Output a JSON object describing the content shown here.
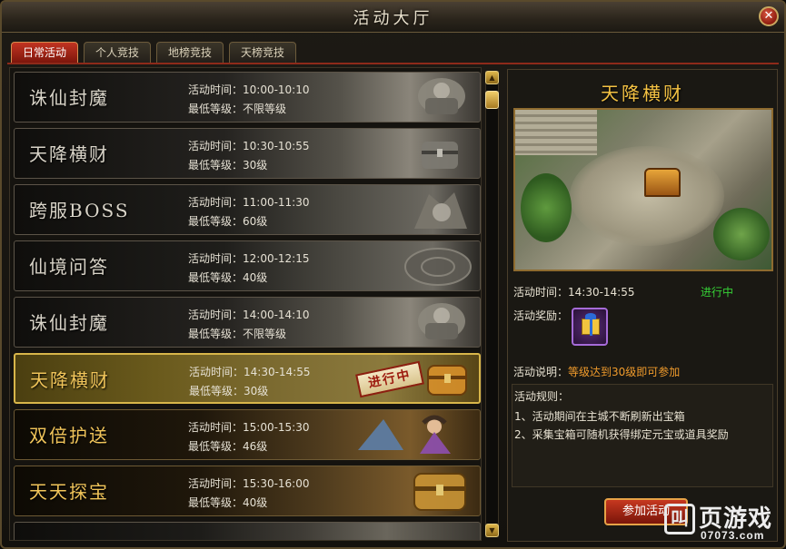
{
  "window": {
    "title": "活动大厅",
    "close_label": "✕"
  },
  "tabs": [
    {
      "label": "日常活动",
      "active": true
    },
    {
      "label": "个人竞技",
      "active": false
    },
    {
      "label": "地榜竞技",
      "active": false
    },
    {
      "label": "天榜竞技",
      "active": false
    }
  ],
  "activities": [
    {
      "name": "诛仙封魔",
      "time": "活动时间：10:00-10:10",
      "level": "最低等级：不限等级",
      "art": "demon-statue-icon"
    },
    {
      "name": "天降横财",
      "time": "活动时间：10:30-10:55",
      "level": "最低等级：30级",
      "art": "treasure-chest-icon"
    },
    {
      "name": "跨服BOSS",
      "time": "活动时间：11:00-11:30",
      "level": "最低等级：60级",
      "art": "boss-portrait-icon"
    },
    {
      "name": "仙境问答",
      "time": "活动时间：12:00-12:15",
      "level": "最低等级：40级",
      "art": "stone-dial-icon"
    },
    {
      "name": "诛仙封魔",
      "time": "活动时间：14:00-14:10",
      "level": "最低等级：不限等级",
      "art": "demon-statue-icon"
    },
    {
      "name": "天降横财",
      "time": "活动时间：14:30-14:55",
      "level": "最低等级：30级",
      "art": "treasure-chest-icon",
      "status": "进行中",
      "selected": true
    },
    {
      "name": "双倍护送",
      "time": "活动时间：15:00-15:30",
      "level": "最低等级：46级",
      "art": "escort-character-icon"
    },
    {
      "name": "天天探宝",
      "time": "活动时间：15:30-16:00",
      "level": "最低等级：40级",
      "art": "gold-chest-icon"
    }
  ],
  "detail": {
    "title": "天降横财",
    "time": "活动时间：14:30-14:55",
    "status": "进行中",
    "reward_label": "活动奖励：",
    "reward_icon": "gift-box-icon",
    "desc_label": "活动说明：",
    "desc_value": "等级达到30级即可参加",
    "rules_heading": "活动规则：",
    "rules": [
      "1、活动期间在主城不断刷新出宝箱",
      "2、采集宝箱可随机获得绑定元宝或道具奖励"
    ],
    "join_label": "参加活动"
  },
  "watermark": {
    "logo": "叫",
    "text": "页游戏",
    "url": "07073.com"
  },
  "colors": {
    "accent_gold": "#f4c243",
    "status_green": "#36d136",
    "tab_active": "#c23422",
    "desc_orange": "#f09b2c"
  }
}
